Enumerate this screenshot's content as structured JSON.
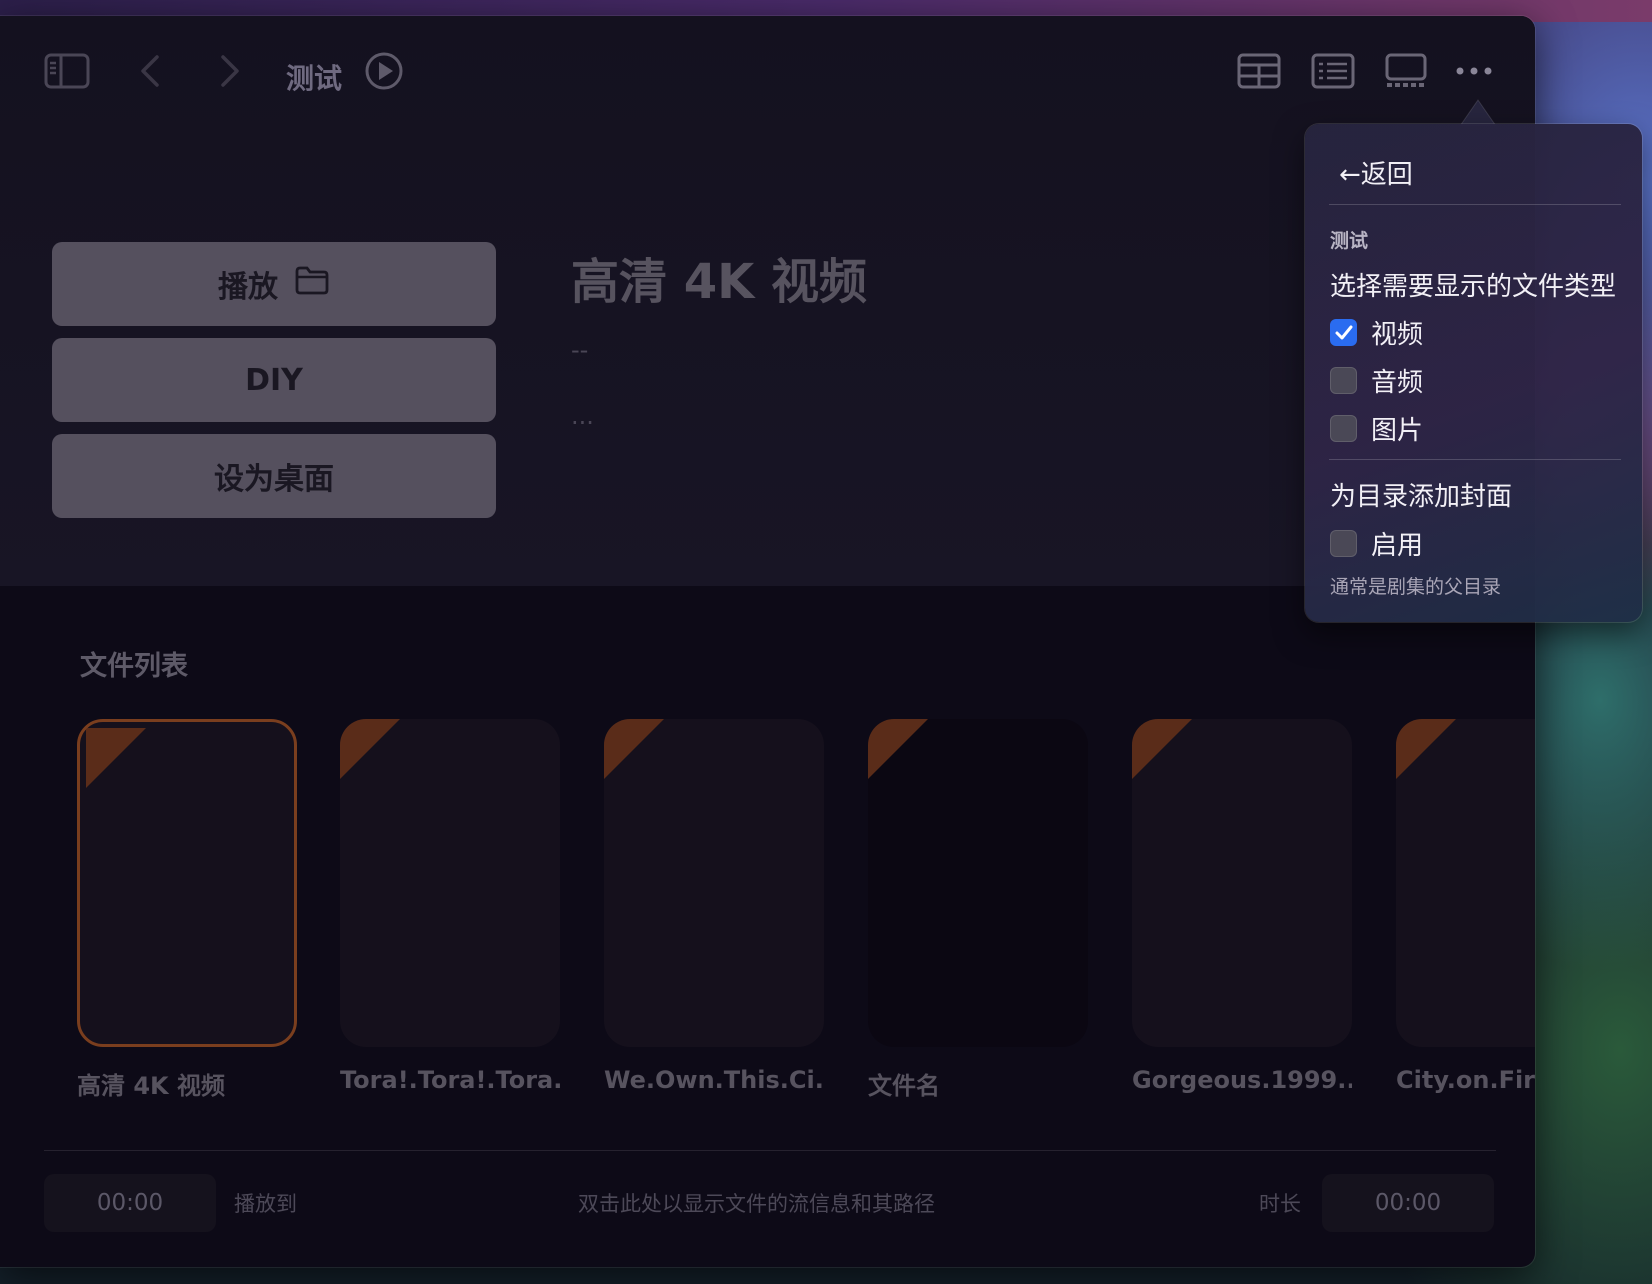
{
  "toolbar": {
    "folder_title": "测试",
    "icons": {
      "sidebar": "sidebar-icon",
      "back": "chevron-left-icon",
      "forward": "chevron-right-icon",
      "play": "play-circle-icon",
      "table_view": "table-view-icon",
      "list_view": "list-view-icon",
      "gallery_view": "gallery-view-icon",
      "more": "ellipsis-icon"
    }
  },
  "actions": {
    "play_label": "播放",
    "diy_label": "DIY",
    "set_desktop_label": "设为桌面"
  },
  "details": {
    "title": "高清 4K 视频",
    "meta_line1": "--",
    "meta_line2": "..."
  },
  "file_list": {
    "section_title": "文件列表",
    "items": [
      {
        "label": "高清 4K 视频",
        "selected": true
      },
      {
        "label": "Tora!.Tora!.Tora...",
        "selected": false
      },
      {
        "label": "We.Own.This.Ci...",
        "selected": false
      },
      {
        "label": "文件名",
        "selected": false
      },
      {
        "label": "Gorgeous.1999...",
        "selected": false
      },
      {
        "label": "City.on.Fire.",
        "selected": false
      }
    ]
  },
  "bottom_bar": {
    "current_time": "00:00",
    "play_to_label": "播放到",
    "stream_hint": "双击此处以显示文件的流信息和其路径",
    "duration_label": "时长",
    "duration_time": "00:00"
  },
  "popover": {
    "back_label": "←返回",
    "section_label": "测试",
    "file_type_header": "选择需要显示的文件类型",
    "file_types": [
      {
        "label": "视频",
        "checked": true
      },
      {
        "label": "音频",
        "checked": false
      },
      {
        "label": "图片",
        "checked": false
      }
    ],
    "cover_header": "为目录添加封面",
    "cover_option": {
      "label": "启用",
      "checked": false
    },
    "cover_note": "通常是剧集的父目录"
  },
  "colors": {
    "accent_blue": "#2a6cf0",
    "card_corner": "#5a2c19",
    "selected_border": "#7a3e1e"
  }
}
